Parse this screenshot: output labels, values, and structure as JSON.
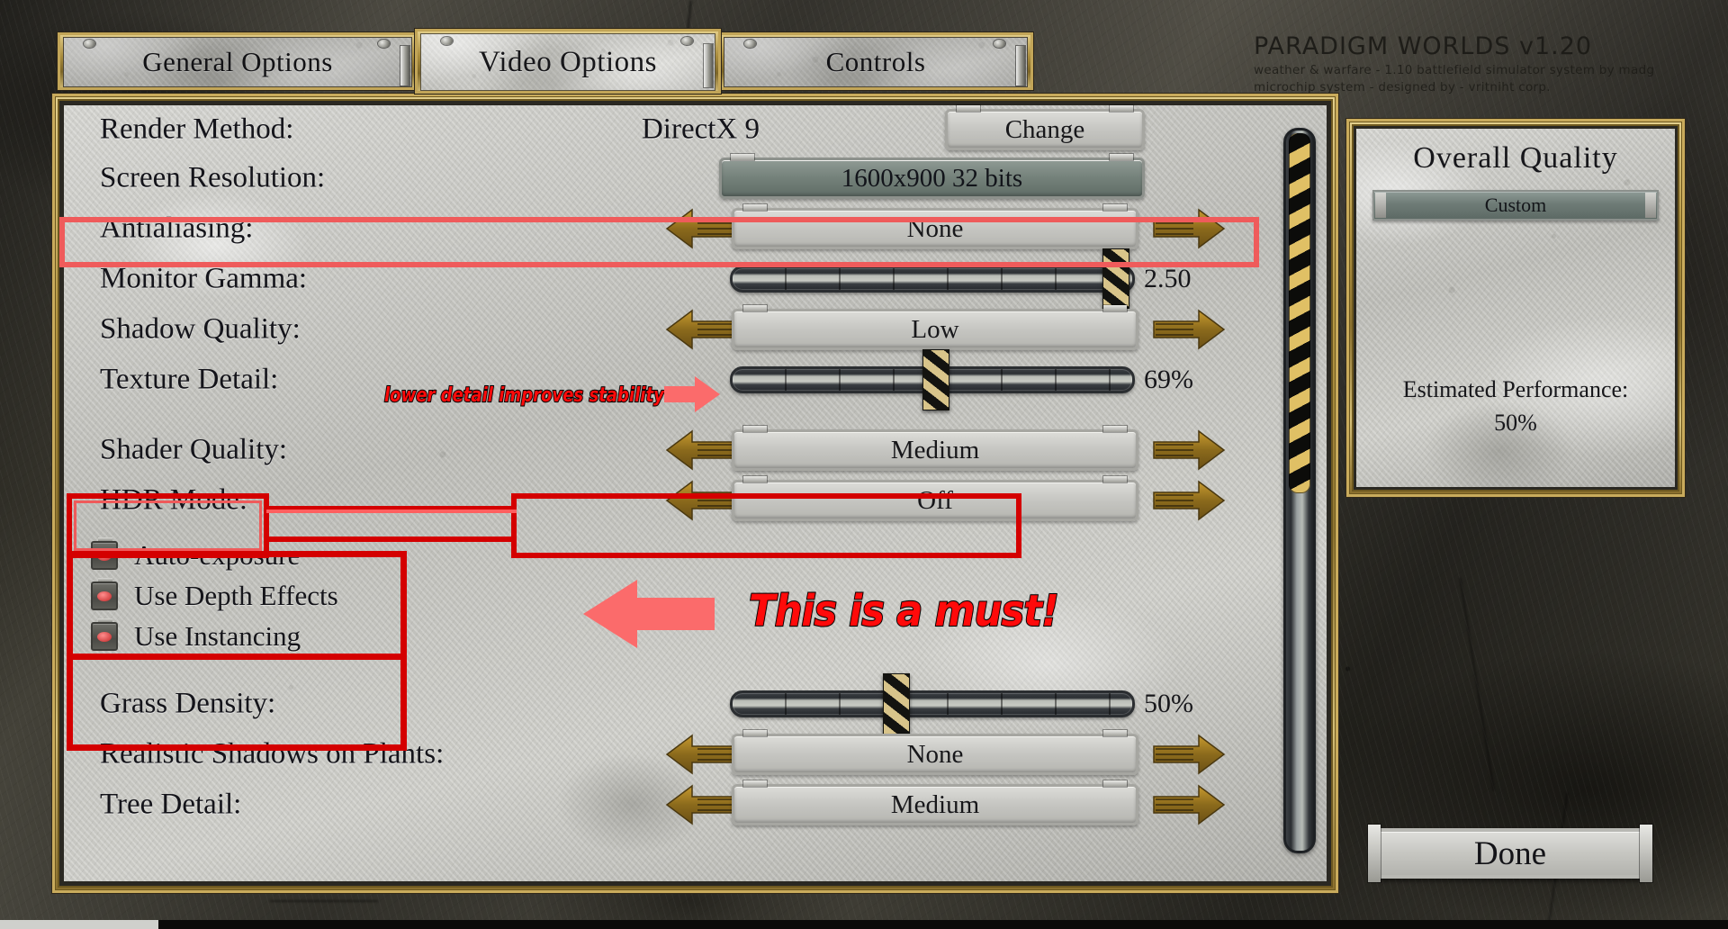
{
  "brand": {
    "title": "PARADIGM WORLDS  v1.20",
    "sub1": "weather & warfare  -  1.10 battlefield  simulator system by madg",
    "sub2": "microchip system  -  designed by  -  vritniht corp."
  },
  "tabs": [
    {
      "label": "General Options",
      "active": false
    },
    {
      "label": "Video Options",
      "active": true
    },
    {
      "label": "Controls",
      "active": false
    }
  ],
  "options": {
    "render_method": {
      "label": "Render Method:",
      "value": "DirectX 9",
      "button": "Change"
    },
    "screen_resolution": {
      "label": "Screen Resolution:",
      "value": "1600x900 32 bits"
    },
    "antialiasing": {
      "label": "Antialiasing:",
      "value": "None"
    },
    "monitor_gamma": {
      "label": "Monitor Gamma:",
      "value": "2.50",
      "percent": 97
    },
    "shadow_quality": {
      "label": "Shadow Quality:",
      "value": "Low"
    },
    "texture_detail": {
      "label": "Texture Detail:",
      "value": "69%",
      "percent": 63
    },
    "shader_quality": {
      "label": "Shader Quality:",
      "value": "Medium"
    },
    "hdr_mode": {
      "label": "HDR Mode:",
      "value": "Off"
    },
    "grass_density": {
      "label": "Grass Density:",
      "value": "50%",
      "percent": 50
    },
    "realistic_shadows": {
      "label": "Realistic Shadows on Plants:",
      "value": "None"
    },
    "tree_detail": {
      "label": "Tree Detail:",
      "value": "Medium"
    }
  },
  "checkboxes": [
    {
      "label": "Auto-exposure",
      "checked": true
    },
    {
      "label": "Use Depth Effects",
      "checked": true
    },
    {
      "label": "Use Instancing",
      "checked": true
    }
  ],
  "quality_panel": {
    "title": "Overall Quality",
    "preset": "Custom",
    "perf_label": "Estimated Performance:",
    "perf_value": "50%"
  },
  "done_label": "Done",
  "annotations": {
    "texture_note": "lower detail improves stability",
    "must_note": "This is a must!"
  },
  "colors": {
    "annotation_red": "#d40000",
    "annotation_text": "#ff0a0a",
    "gold": "#c9ab5c",
    "stone": "#c3c3bf"
  },
  "scrollbar": {
    "thumb_percent": 50
  }
}
